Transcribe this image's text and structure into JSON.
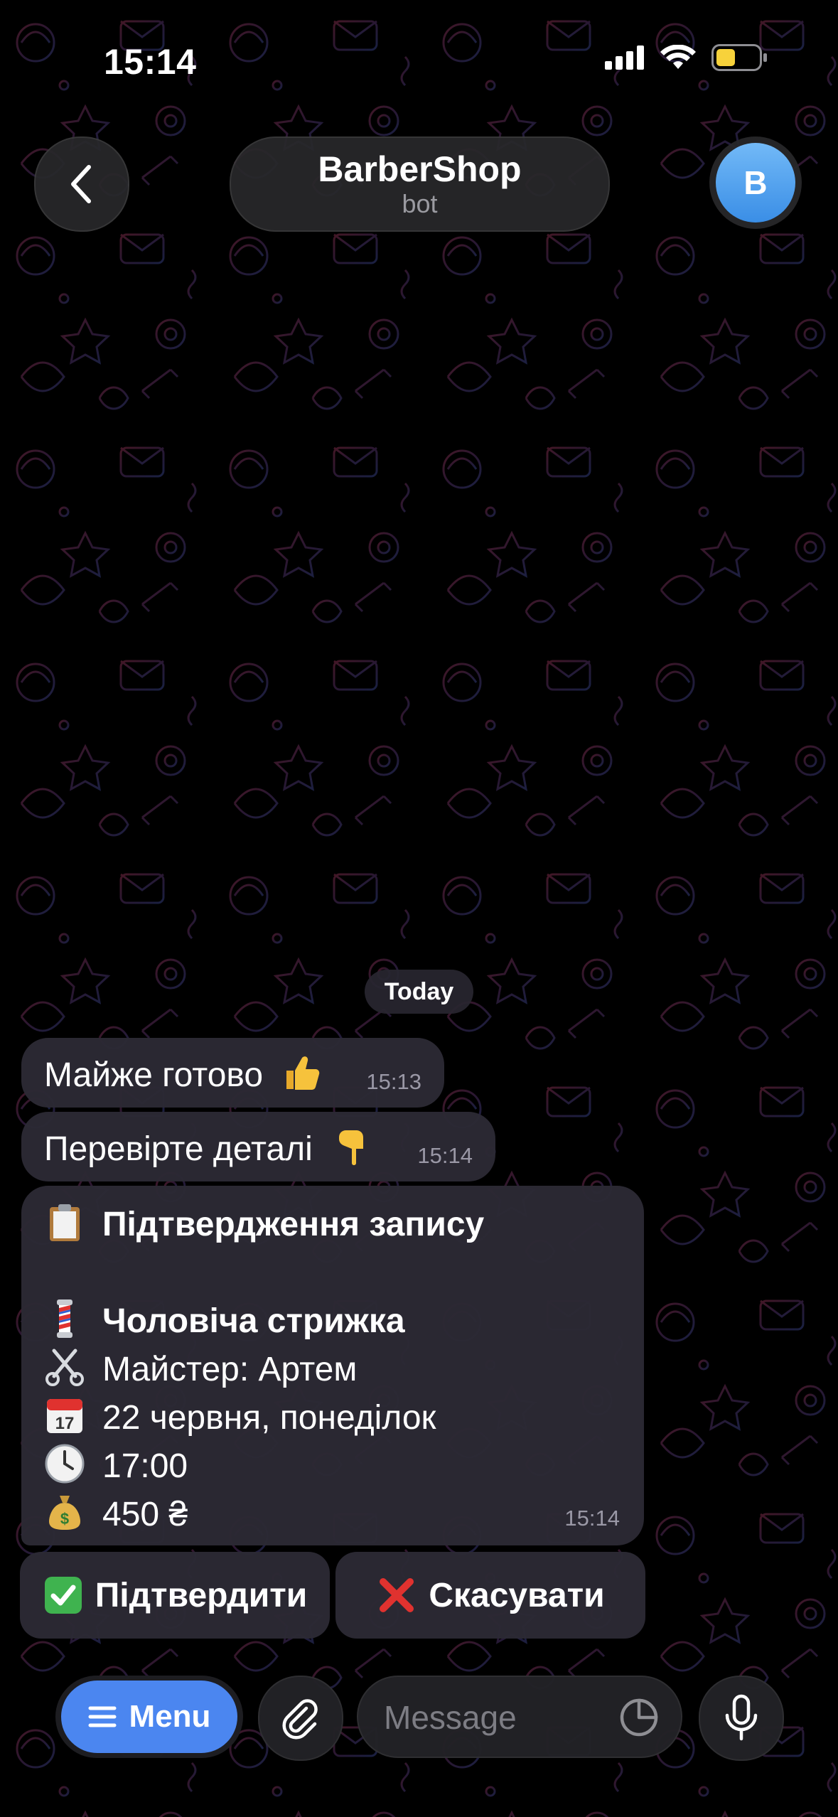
{
  "status_bar": {
    "time": "15:14"
  },
  "header": {
    "back_icon": "chevron-left-icon",
    "title": "BarberShop",
    "subtitle": "bot",
    "avatar_letter": "B"
  },
  "chat": {
    "date_chip": "Today",
    "messages": [
      {
        "text": "Майже готово",
        "emoji": "thumbs-up",
        "time": "15:13"
      },
      {
        "text": "Перевірте деталі",
        "emoji": "point-down",
        "time": "15:14"
      }
    ],
    "confirmation": {
      "title": "Підтвердження запису",
      "service": "Чоловіча стрижка",
      "master": "Майстер: Артем",
      "date": "22 червня, понеділок",
      "time_slot": "17:00",
      "price": "450 ₴",
      "time": "15:14"
    }
  },
  "keyboard": {
    "confirm_label": "Підтвердити",
    "cancel_label": "Скасувати"
  },
  "input_bar": {
    "menu_label": "Menu",
    "placeholder": "Message"
  },
  "colors": {
    "accent": "#4b86f0",
    "bubble": "#2c2a34",
    "background": "#000000"
  }
}
